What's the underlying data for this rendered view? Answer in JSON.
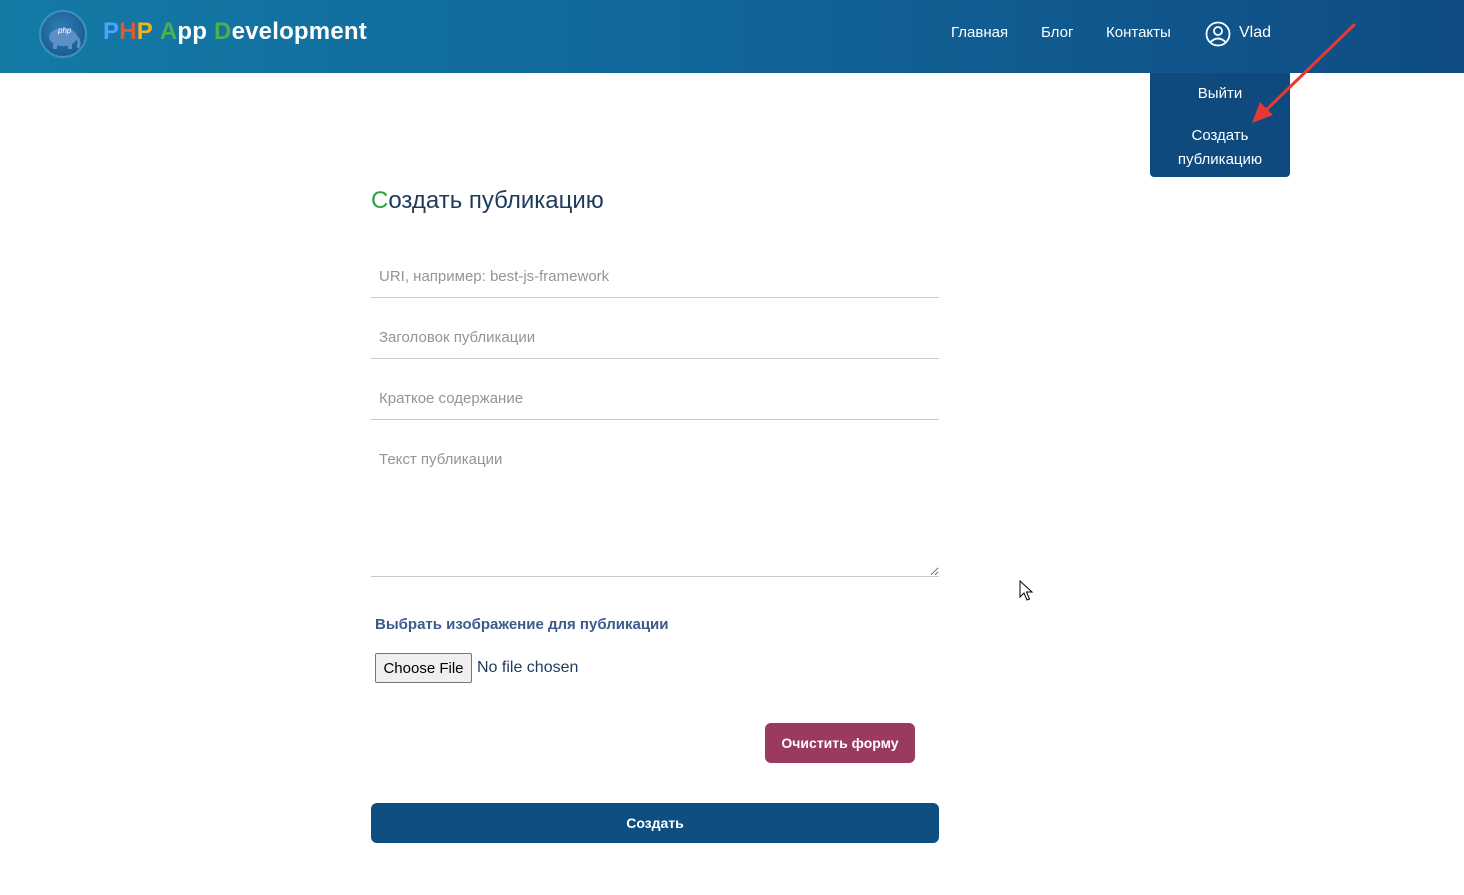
{
  "header": {
    "brand": {
      "logo_icon": "php-elephant-icon",
      "logo_text": "php",
      "letters": [
        {
          "text": "P",
          "color": "#4aa3ff"
        },
        {
          "text": "H",
          "color": "#e4572e"
        },
        {
          "text": "P",
          "color": "#f2b21a"
        },
        {
          "text": " ",
          "color": "#ffffff"
        },
        {
          "text": "A",
          "color": "#4caf50"
        },
        {
          "text": "pp",
          "color": "#ffffff"
        },
        {
          "text": " ",
          "color": "#ffffff"
        },
        {
          "text": "D",
          "color": "#4caf50"
        },
        {
          "text": "evelopment",
          "color": "#ffffff"
        }
      ]
    },
    "nav": {
      "home": "Главная",
      "blog": "Блог",
      "contacts": "Контакты"
    },
    "user": {
      "icon": "user-circle-icon",
      "name": "Vlad"
    }
  },
  "dropdown": {
    "logout": "Выйти",
    "create_line1": "Создать",
    "create_line2": "публикацию"
  },
  "form": {
    "title_first_letter": "С",
    "title_rest": "оздать публикацию",
    "uri_placeholder": "URI, например: best-js-framework",
    "title_placeholder": "Заголовок публикации",
    "summary_placeholder": "Краткое содержание",
    "text_placeholder": "Текст публикации",
    "image_label": "Выбрать изображение для публикации",
    "file_button": "Choose File",
    "file_status": "No file chosen",
    "clear_button": "Очистить форму",
    "submit_button": "Создать"
  },
  "colors": {
    "header_start": "#137aa6",
    "header_end": "#0f4c83",
    "dropdown_bg": "#0f4a7f",
    "accent_green": "#2ea043",
    "clear_button": "#9b3a5f",
    "submit_button": "#0f4e80",
    "annotation_arrow": "#e53935"
  }
}
